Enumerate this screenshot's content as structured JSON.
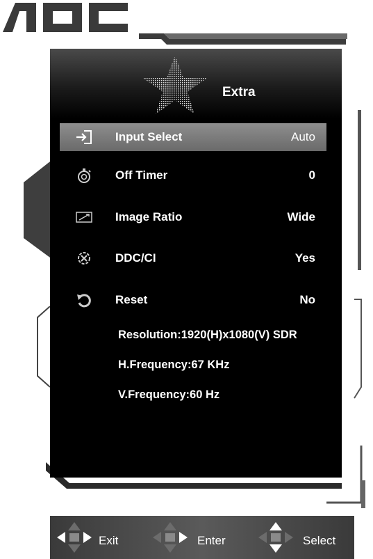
{
  "brand": {
    "logo_text": "AOC"
  },
  "osd": {
    "title": "Extra",
    "items": [
      {
        "icon": "input-source-icon",
        "label": "Input Select",
        "value": "Auto",
        "selected": true
      },
      {
        "icon": "stopwatch-icon",
        "label": "Off Timer",
        "value": "0",
        "selected": false
      },
      {
        "icon": "image-ratio-icon",
        "label": "Image Ratio",
        "value": "Wide",
        "selected": false
      },
      {
        "icon": "ddc-ci-icon",
        "label": "DDC/CI",
        "value": "Yes",
        "selected": false
      },
      {
        "icon": "reset-icon",
        "label": "Reset",
        "value": "No",
        "selected": false
      }
    ],
    "info": {
      "resolution": "Resolution:1920(H)x1080(V) SDR",
      "h_frequency": "H.Frequency:67 KHz",
      "v_frequency": "V.Frequency:60 Hz"
    }
  },
  "bottom_bar": {
    "exit_label": "Exit",
    "enter_label": "Enter",
    "select_label": "Select"
  },
  "colors": {
    "selected_row": "#7c7c7c",
    "panel_bg": "#000000",
    "bar_bg": "#4a4a4a"
  }
}
